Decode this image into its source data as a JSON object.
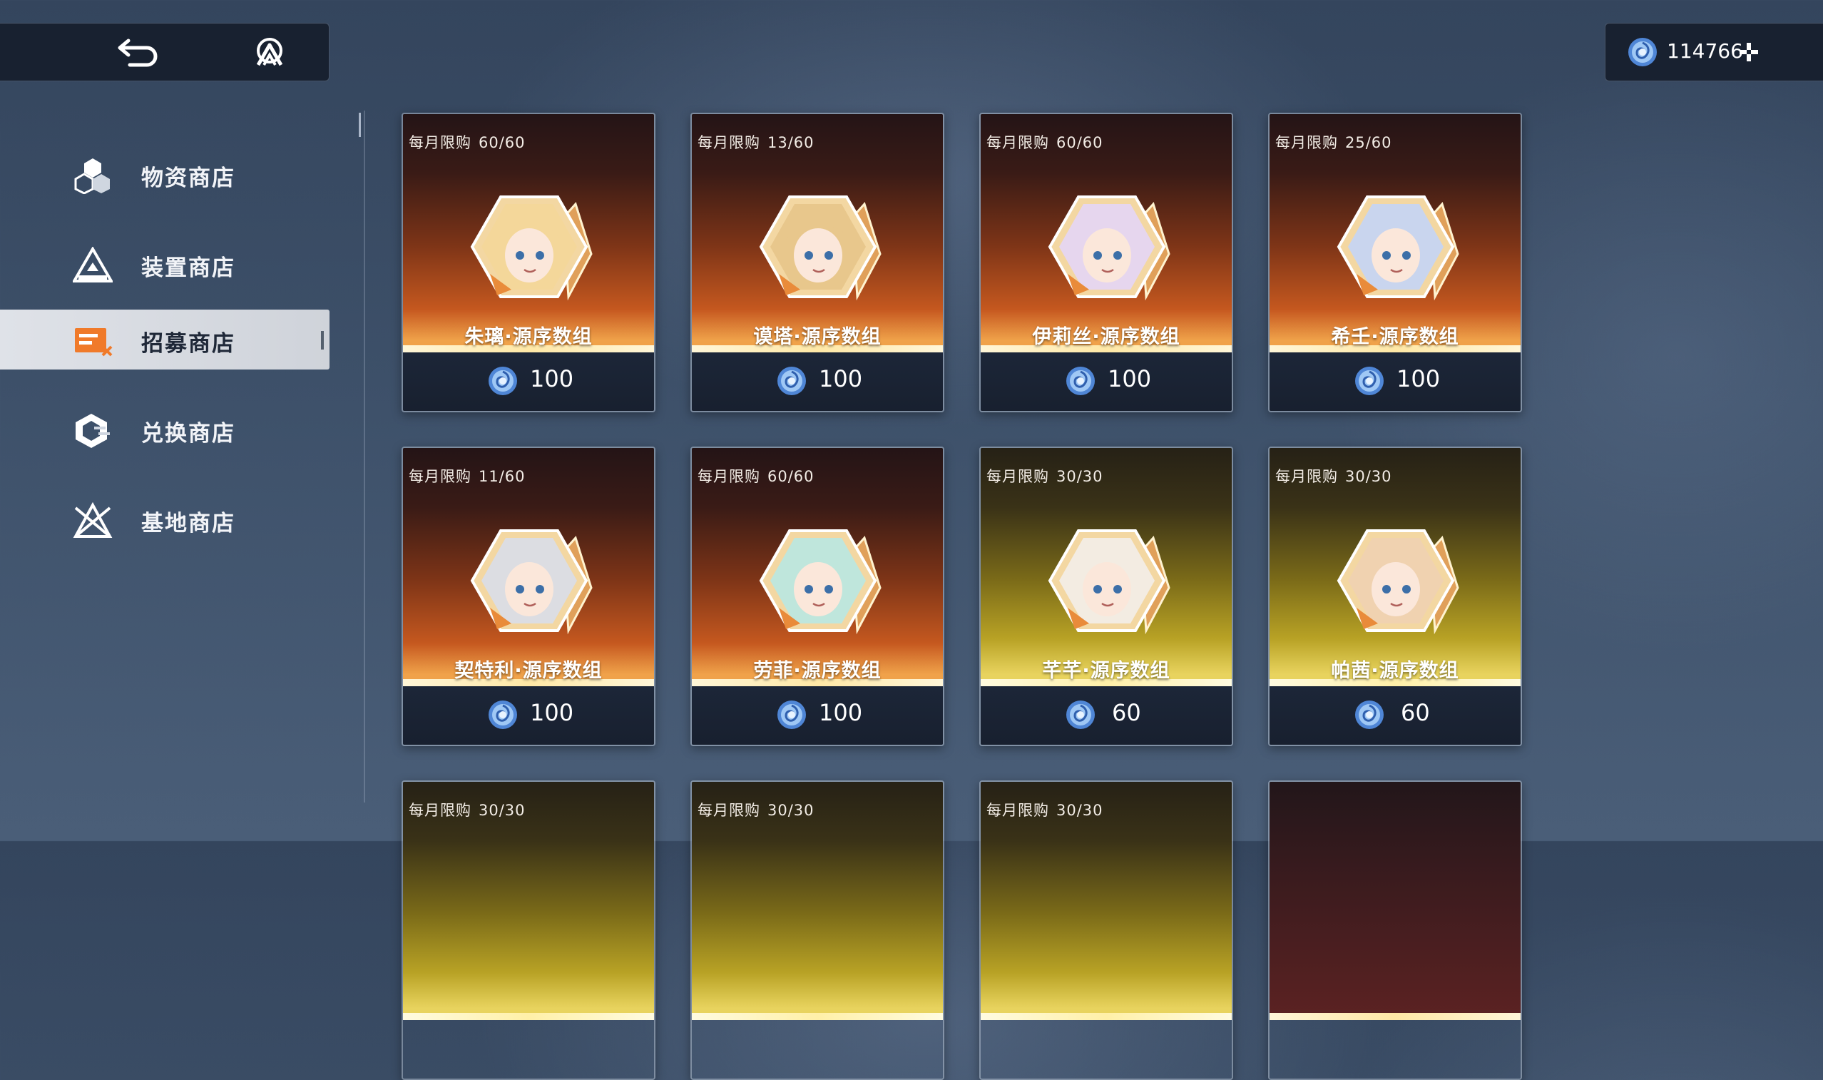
{
  "top": {
    "currency_amount": "114766"
  },
  "sidebar": {
    "items": [
      {
        "label": "物资商店",
        "icon": "supply-icon",
        "active": false
      },
      {
        "label": "装置商店",
        "icon": "device-icon",
        "active": false
      },
      {
        "label": "招募商店",
        "icon": "recruit-icon",
        "active": true
      },
      {
        "label": "兑换商店",
        "icon": "exchange-icon",
        "active": false
      },
      {
        "label": "基地商店",
        "icon": "base-icon",
        "active": false
      }
    ]
  },
  "shop": {
    "limit_label": "每月限购",
    "cards": [
      {
        "name": "朱璃·源序数组",
        "limit": "60/60",
        "price": "100",
        "theme": "orange",
        "hair": "#f4d79a"
      },
      {
        "name": "谟塔·源序数组",
        "limit": "13/60",
        "price": "100",
        "theme": "orange",
        "hair": "#e8c78c"
      },
      {
        "name": "伊莉丝·源序数组",
        "limit": "60/60",
        "price": "100",
        "theme": "orange",
        "hair": "#e6d6ee"
      },
      {
        "name": "希壬·源序数组",
        "limit": "25/60",
        "price": "100",
        "theme": "orange",
        "hair": "#c9d5ee"
      },
      {
        "name": "契特利·源序数组",
        "limit": "11/60",
        "price": "100",
        "theme": "orange",
        "hair": "#dcdde2"
      },
      {
        "name": "劳菲·源序数组",
        "limit": "60/60",
        "price": "100",
        "theme": "orange",
        "hair": "#bfe6dc"
      },
      {
        "name": "芊芊·源序数组",
        "limit": "30/30",
        "price": "60",
        "theme": "gold",
        "hair": "#f3ece2"
      },
      {
        "name": "帕茜·源序数组",
        "limit": "30/30",
        "price": "60",
        "theme": "gold",
        "hair": "#f0d2b0"
      },
      {
        "name": "",
        "limit": "30/30",
        "price": "",
        "theme": "gold",
        "hair": ""
      },
      {
        "name": "",
        "limit": "30/30",
        "price": "",
        "theme": "gold",
        "hair": ""
      },
      {
        "name": "",
        "limit": "30/30",
        "price": "",
        "theme": "gold",
        "hair": ""
      },
      {
        "name": "",
        "limit": "",
        "price": "",
        "theme": "crimson",
        "hair": ""
      }
    ]
  },
  "colors": {
    "accent_orange": "#f07a2a",
    "crystal_blue": "#6fa6e8"
  }
}
